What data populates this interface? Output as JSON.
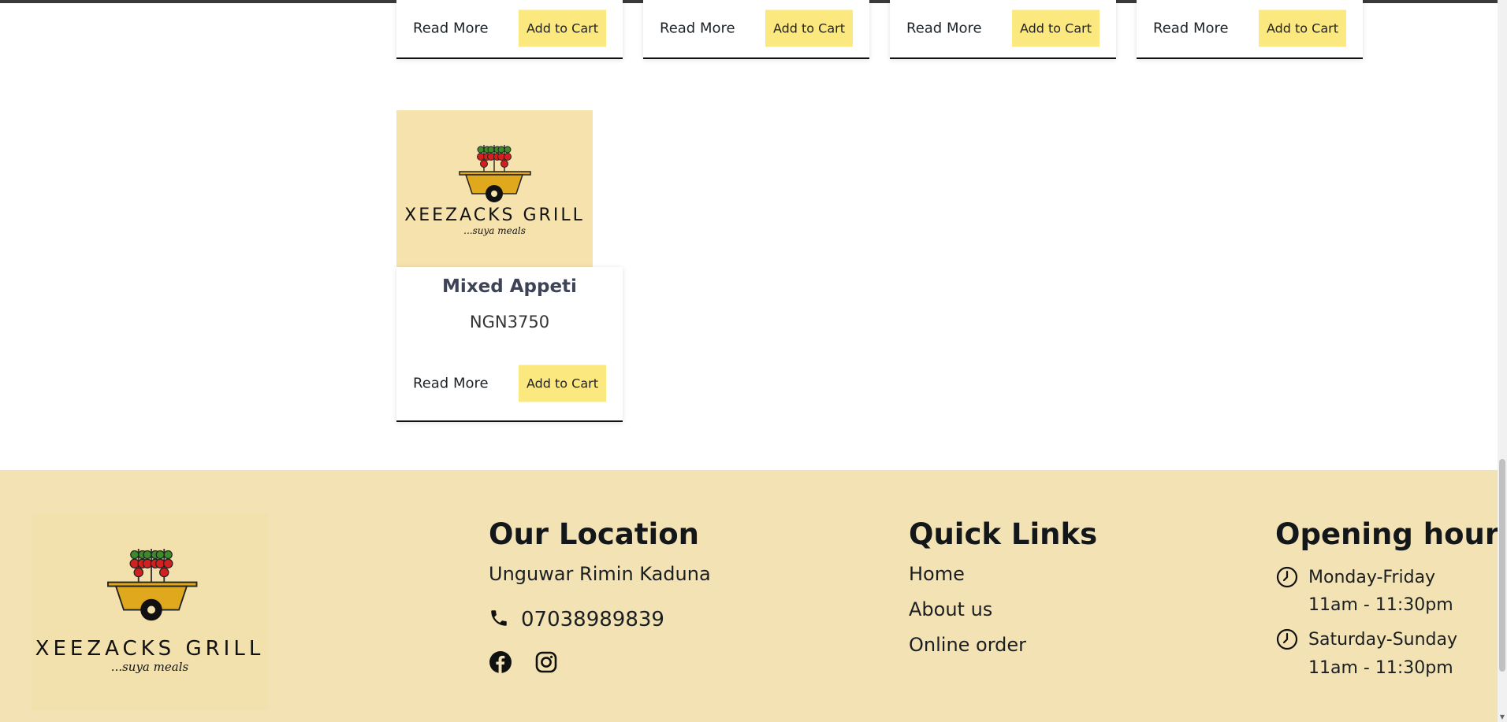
{
  "products_top": [
    {
      "read_more": "Read More",
      "add_to_cart": "Add to Cart"
    },
    {
      "read_more": "Read More",
      "add_to_cart": "Add to Cart"
    },
    {
      "read_more": "Read More",
      "add_to_cart": "Add to Cart"
    },
    {
      "read_more": "Read More",
      "add_to_cart": "Add to Cart"
    }
  ],
  "product": {
    "name": "Mixed Appeti",
    "price": "NGN3750",
    "read_more": "Read More",
    "add_to_cart": "Add to Cart",
    "logo_brand": "XEEZACKS GRILL",
    "logo_tagline": "...suya meals"
  },
  "footer": {
    "logo_brand": "XEEZACKS GRILL",
    "logo_tagline": "...suya meals",
    "location": {
      "heading": "Our Location",
      "address": "Unguwar Rimin Kaduna",
      "phone": "07038989839",
      "socials": [
        "facebook-icon",
        "instagram-icon"
      ]
    },
    "quick_links": {
      "heading": "Quick Links",
      "items": [
        "Home",
        "About us",
        "Online order"
      ]
    },
    "hours": {
      "heading": "Opening hours",
      "entries": [
        {
          "days": "Monday-Friday",
          "time": "11am - 11:30pm"
        },
        {
          "days": "Saturday-Sunday",
          "time": "11am - 11:30pm"
        }
      ]
    }
  },
  "colors": {
    "accent_button": "#fbe97f",
    "footer_bg": "#f3e3b4",
    "logo_bg": "#f6e2ad",
    "cart_body": "#e0a81c"
  }
}
